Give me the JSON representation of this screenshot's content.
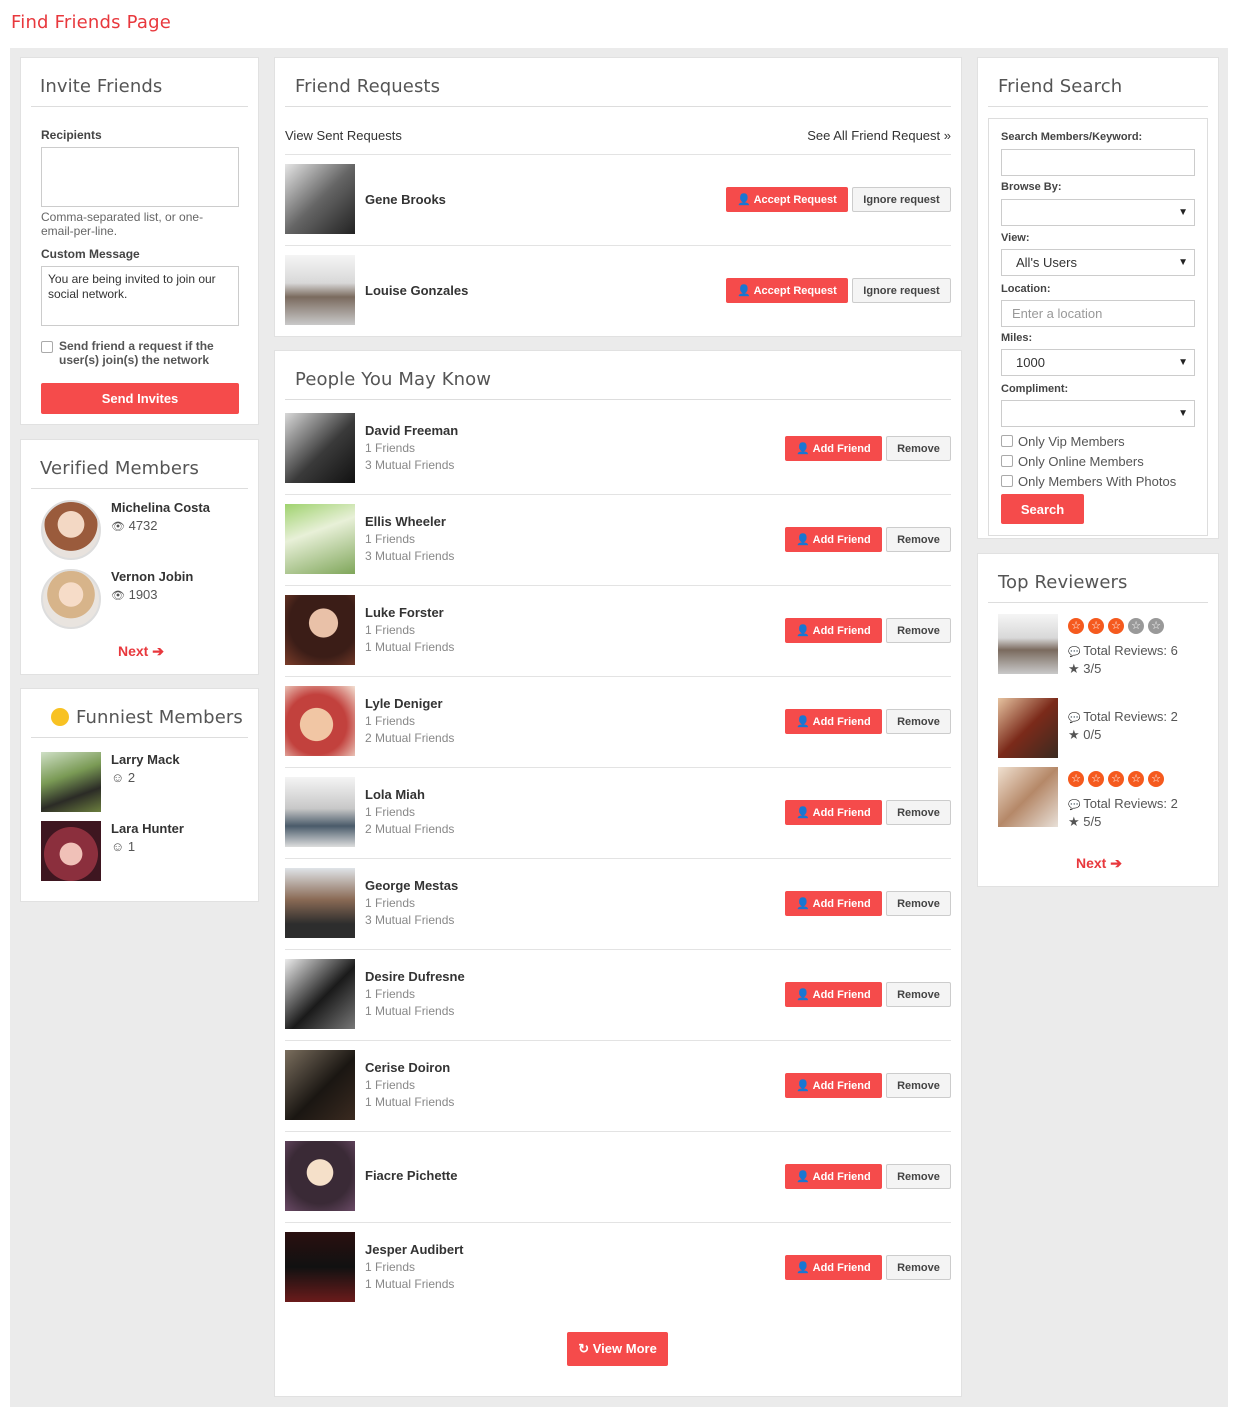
{
  "page_title": "Find Friends Page",
  "invite": {
    "title": "Invite Friends",
    "recipients_label": "Recipients",
    "recipients_hint": "Comma-separated list, or one-email-per-line.",
    "message_label": "Custom Message",
    "message_value": "You are being invited to join our social network.",
    "checkbox_label": "Send friend a request if the user(s) join(s) the network",
    "submit": "Send Invites"
  },
  "verified": {
    "title": "Verified Members",
    "members": [
      {
        "name": "Michelina Costa",
        "views": "4732"
      },
      {
        "name": "Vernon Jobin",
        "views": "1903"
      }
    ],
    "next": "Next"
  },
  "funniest": {
    "title": "Funniest Members",
    "members": [
      {
        "name": "Larry Mack",
        "count": "2"
      },
      {
        "name": "Lara Hunter",
        "count": "1"
      }
    ]
  },
  "requests": {
    "title": "Friend Requests",
    "view_sent": "View Sent Requests",
    "see_all": "See All Friend Request »",
    "accept": "Accept Request",
    "ignore": "Ignore request",
    "items": [
      {
        "name": "Gene Brooks"
      },
      {
        "name": "Louise Gonzales"
      }
    ]
  },
  "pymk": {
    "title": "People You May Know",
    "add": "Add Friend",
    "remove": "Remove",
    "view_more": "View More",
    "people": [
      {
        "name": "David Freeman",
        "friends": "1 Friends",
        "mutual": "3 Mutual Friends"
      },
      {
        "name": "Ellis Wheeler",
        "friends": "1 Friends",
        "mutual": "3 Mutual Friends"
      },
      {
        "name": "Luke Forster",
        "friends": "1 Friends",
        "mutual": "1 Mutual Friends"
      },
      {
        "name": "Lyle Deniger",
        "friends": "1 Friends",
        "mutual": "2 Mutual Friends"
      },
      {
        "name": "Lola Miah",
        "friends": "1 Friends",
        "mutual": "2 Mutual Friends"
      },
      {
        "name": "George Mestas",
        "friends": "1 Friends",
        "mutual": "3 Mutual Friends"
      },
      {
        "name": "Desire Dufresne",
        "friends": "1 Friends",
        "mutual": "1 Mutual Friends"
      },
      {
        "name": "Cerise Doiron",
        "friends": "1 Friends",
        "mutual": "1 Mutual Friends"
      },
      {
        "name": "Fiacre Pichette",
        "friends": "",
        "mutual": ""
      },
      {
        "name": "Jesper Audibert",
        "friends": "1 Friends",
        "mutual": "1 Mutual Friends"
      }
    ]
  },
  "search": {
    "title": "Friend Search",
    "keyword_label": "Search Members/Keyword:",
    "browse_label": "Browse By:",
    "view_label": "View:",
    "view_value": "All's Users",
    "location_label": "Location:",
    "location_placeholder": "Enter a location",
    "miles_label": "Miles:",
    "miles_value": "1000",
    "compliment_label": "Compliment:",
    "only_vip": "Only Vip Members",
    "only_online": "Only Online Members",
    "only_photos": "Only Members With Photos",
    "submit": "Search"
  },
  "reviewers": {
    "title": "Top Reviewers",
    "items": [
      {
        "stars": 3,
        "show_stars": true,
        "reviews": "Total Reviews: 6",
        "rating": "3/5"
      },
      {
        "stars": 0,
        "show_stars": false,
        "reviews": "Total Reviews: 2",
        "rating": "0/5"
      },
      {
        "stars": 5,
        "show_stars": true,
        "reviews": "Total Reviews: 2",
        "rating": "5/5"
      }
    ],
    "next": "Next"
  },
  "colors": {
    "accent": "#f54b4b",
    "star": "#f55a1e",
    "background": "#ebebeb"
  }
}
